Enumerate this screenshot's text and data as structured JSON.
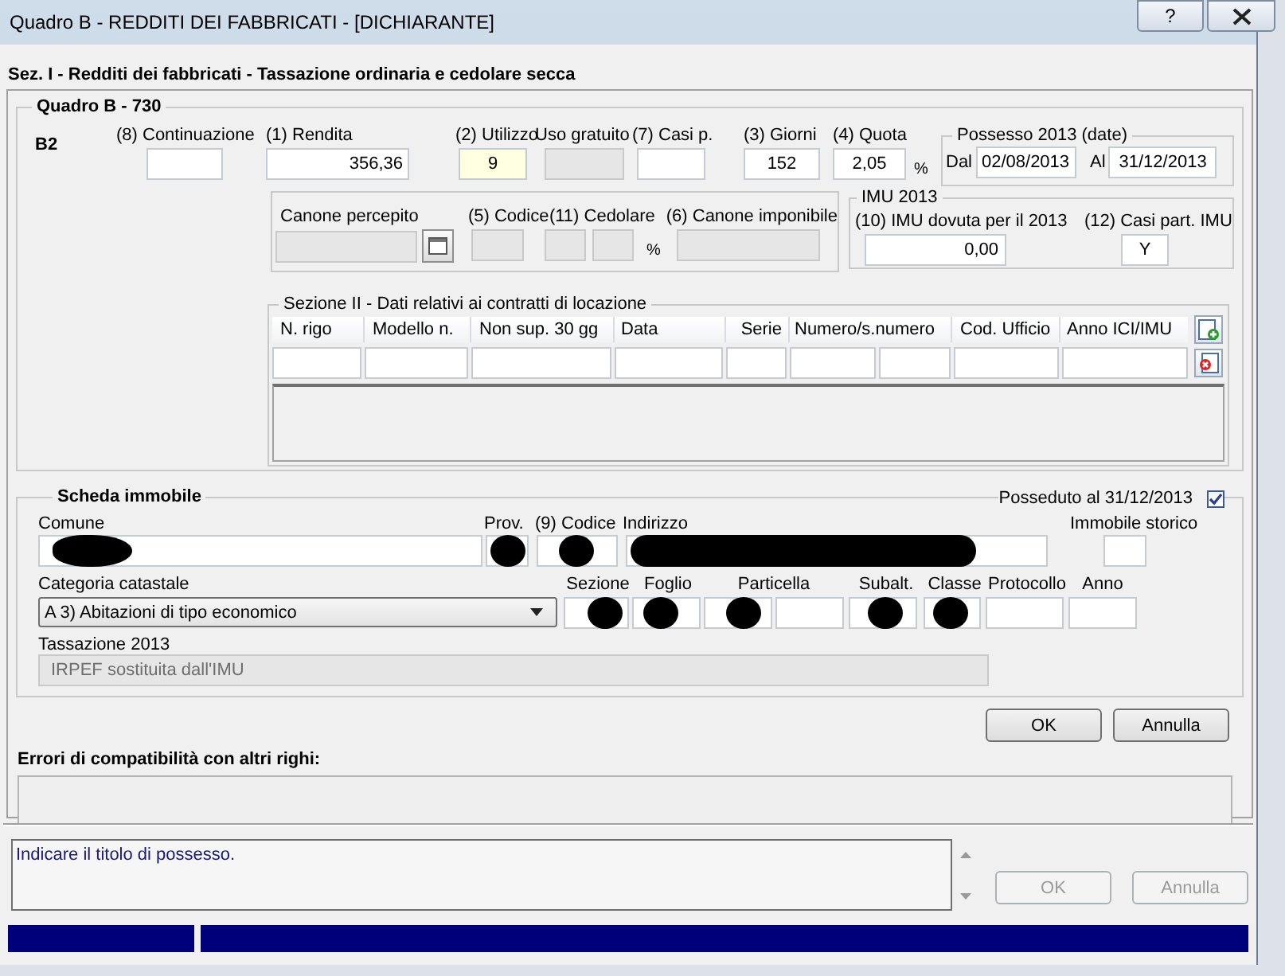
{
  "window": {
    "title": "Quadro B - REDDITI DEI FABBRICATI - [DICHIARANTE]",
    "help_button": "?"
  },
  "section_title": "Sez. I - Redditi dei fabbricati -  Tassazione ordinaria e cedolare secca",
  "quadro": {
    "legend": "Quadro B - 730",
    "row_label": "B2",
    "fields": [
      {
        "label": "(8) Continuazione",
        "disabled": false,
        "highlighted": false
      },
      {
        "label": "(1) Rendita",
        "value": "356,36",
        "disabled": false,
        "highlighted": false
      },
      {
        "label": "(2) Utilizzo",
        "value": "9",
        "disabled": false,
        "highlighted": true
      },
      {
        "label": "Uso gratuito",
        "disabled": true,
        "highlighted": false
      },
      {
        "label": "(7) Casi p.",
        "disabled": false,
        "highlighted": false
      },
      {
        "label": "(3) Giorni",
        "value": "152",
        "disabled": false,
        "highlighted": false
      },
      {
        "label": "(4) Quota",
        "value": "2,05",
        "suffix": "%",
        "disabled": false,
        "highlighted": false
      }
    ],
    "possesso": {
      "legend": "Possesso 2013 (date)",
      "from_label": "Dal",
      "from": "02/08/2013",
      "to_label": "Al",
      "to": "31/12/2013"
    },
    "canone": [
      {
        "label": "Canone percepito",
        "kind": "picker",
        "disabled": true
      },
      {
        "label": "(5) Codice",
        "kind": "single",
        "disabled": true
      },
      {
        "label": "(11) Cedolare",
        "kind": "split",
        "suffix": "%",
        "disabled": true
      },
      {
        "label": "(6) Canone imponibile",
        "kind": "single",
        "disabled": true
      }
    ],
    "imu": {
      "legend": "IMU 2013",
      "fields": [
        {
          "label": "(10) IMU dovuta per il 2013",
          "value": "0,00"
        },
        {
          "label": "(12) Casi part. IMU",
          "value": "Y"
        }
      ]
    },
    "sezione2": {
      "legend": "Sezione II - Dati relativi ai contratti di locazione",
      "columns": [
        "N. rigo",
        "Modello n.",
        "Non sup. 30 gg",
        "Data",
        "Serie",
        "Numero/s.numero",
        "Cod. Ufficio",
        "Anno ICI/IMU"
      ]
    }
  },
  "scheda": {
    "legend": "Scheda immobile",
    "posseduto": {
      "label": "Posseduto al 31/12/2013",
      "checked": true
    },
    "row1": [
      {
        "label": "Comune",
        "redacted": true
      },
      {
        "label": "Prov.",
        "redacted": true
      },
      {
        "label": "(9) Codice",
        "redacted": true
      },
      {
        "label": "Indirizzo",
        "redacted": true
      },
      {
        "label": "Immobile storico",
        "redacted": false
      }
    ],
    "categoria": {
      "label": "Categoria catastale",
      "value": "A 3) Abitazioni di tipo economico"
    },
    "row2": [
      {
        "label": "Sezione",
        "kind": "single",
        "redacted": true
      },
      {
        "label": "Foglio",
        "kind": "single",
        "redacted": true
      },
      {
        "label": "Particella",
        "kind": "split",
        "redacted": true
      },
      {
        "label": "Subalt.",
        "kind": "single",
        "redacted": true
      },
      {
        "label": "Classe",
        "kind": "single",
        "redacted": true
      },
      {
        "label": "Protocollo",
        "kind": "single",
        "redacted": false
      },
      {
        "label": "Anno",
        "kind": "single",
        "redacted": false
      }
    ],
    "tassazione": {
      "label": "Tassazione 2013",
      "value": "IRPEF sostituita dall'IMU",
      "disabled": true
    }
  },
  "buttons": [
    {
      "label": "OK",
      "disabled": false
    },
    {
      "label": "Annulla",
      "disabled": false
    }
  ],
  "errori": {
    "label": "Errori di compatibilità con altri righi:"
  },
  "message": "Indicare il titolo di possesso.",
  "footer_buttons": [
    {
      "label": "OK",
      "disabled": true
    },
    {
      "label": "Annulla",
      "disabled": true
    }
  ]
}
